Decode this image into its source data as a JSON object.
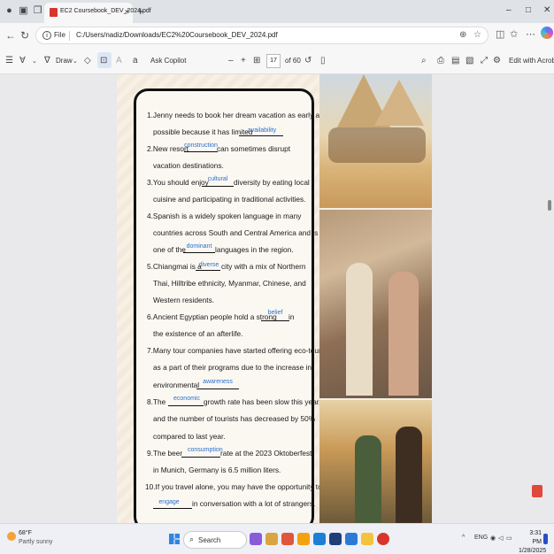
{
  "browser": {
    "tab_title": "EC2 Coursebook_DEV_2024.pdf",
    "tab_close": "×",
    "new_tab": "+",
    "window_controls": [
      "–",
      "□",
      "✕"
    ],
    "address_label": "File",
    "url": "C:/Users/nadiz/Downloads/EC2%20Coursebook_DEV_2024.pdf"
  },
  "pdf_toolbar": {
    "draw_label": "Draw",
    "ask_copilot": "Ask Copilot",
    "zoom_out": "–",
    "zoom_in": "+",
    "page_current": "17",
    "page_total": "of 60",
    "edit_acrobat": "Edit with Acrobat"
  },
  "exercise": {
    "items": [
      {
        "num": "1.",
        "line1_before": "Jenny needs to book her dream vacation as early as",
        "line2_before": "possible because it has limited ",
        "answer": "availability",
        "line2_after": ""
      },
      {
        "num": "2.",
        "line1_before": "New resort ",
        "answer": "construction",
        "line1_after": " can sometimes disrupt",
        "line2": "vacation destinations."
      },
      {
        "num": "3.",
        "line1_before": "You should enjoy ",
        "answer": "cultural",
        "line1_after": " diversity by eating local",
        "line2": "cuisine and participating in traditional activities."
      },
      {
        "num": "4.",
        "line1": "Spanish is a widely spoken language in many",
        "line2": "countries across South and Central America and is",
        "line3_before": "one of the ",
        "answer": "dominant",
        "line3_after": " languages in the region."
      },
      {
        "num": "5.",
        "line1_before": "Chiangmai is a ",
        "answer": "diverse",
        "line1_after": " city with a mix of Northern",
        "line2": "Thai, Hilltribe ethnicity, Myanmar, Chinese, and",
        "line3": "Western residents."
      },
      {
        "num": "6.",
        "line1_before": "Ancient Egyptian people hold a strong ",
        "answer": "belief",
        "line1_after": " in",
        "line2": "the existence of an afterlife."
      },
      {
        "num": "7.",
        "line1": "Many tour companies have started offering eco-tours",
        "line2": "as a part of their programs due to the increase in",
        "line3_before": "environmental ",
        "answer": "awareness"
      },
      {
        "num": "8.",
        "line1_before": "The ",
        "answer": "economic",
        "line1_after": " growth rate has been slow this year,",
        "line2": "and the number of tourists has decreased by 50%",
        "line3": "compared to last year."
      },
      {
        "num": "9.",
        "line1_before": "The beer ",
        "answer": "consumption",
        "line1_after": " rate at the 2023 Oktoberfest",
        "line2": "in Munich, Germany is 6.5 million liters."
      },
      {
        "num": "10.",
        "line1": "If you travel alone, you may have the opportunity to",
        "line2_before": "",
        "answer": "engage",
        "line2_after": " in conversation with a lot of strangers."
      }
    ]
  },
  "taskbar": {
    "weather_temp": "68°F",
    "weather_desc": "Partly sunny",
    "search_label": "Search",
    "lang": "ENG",
    "time": "3:31 PM",
    "date": "1/28/2025"
  }
}
